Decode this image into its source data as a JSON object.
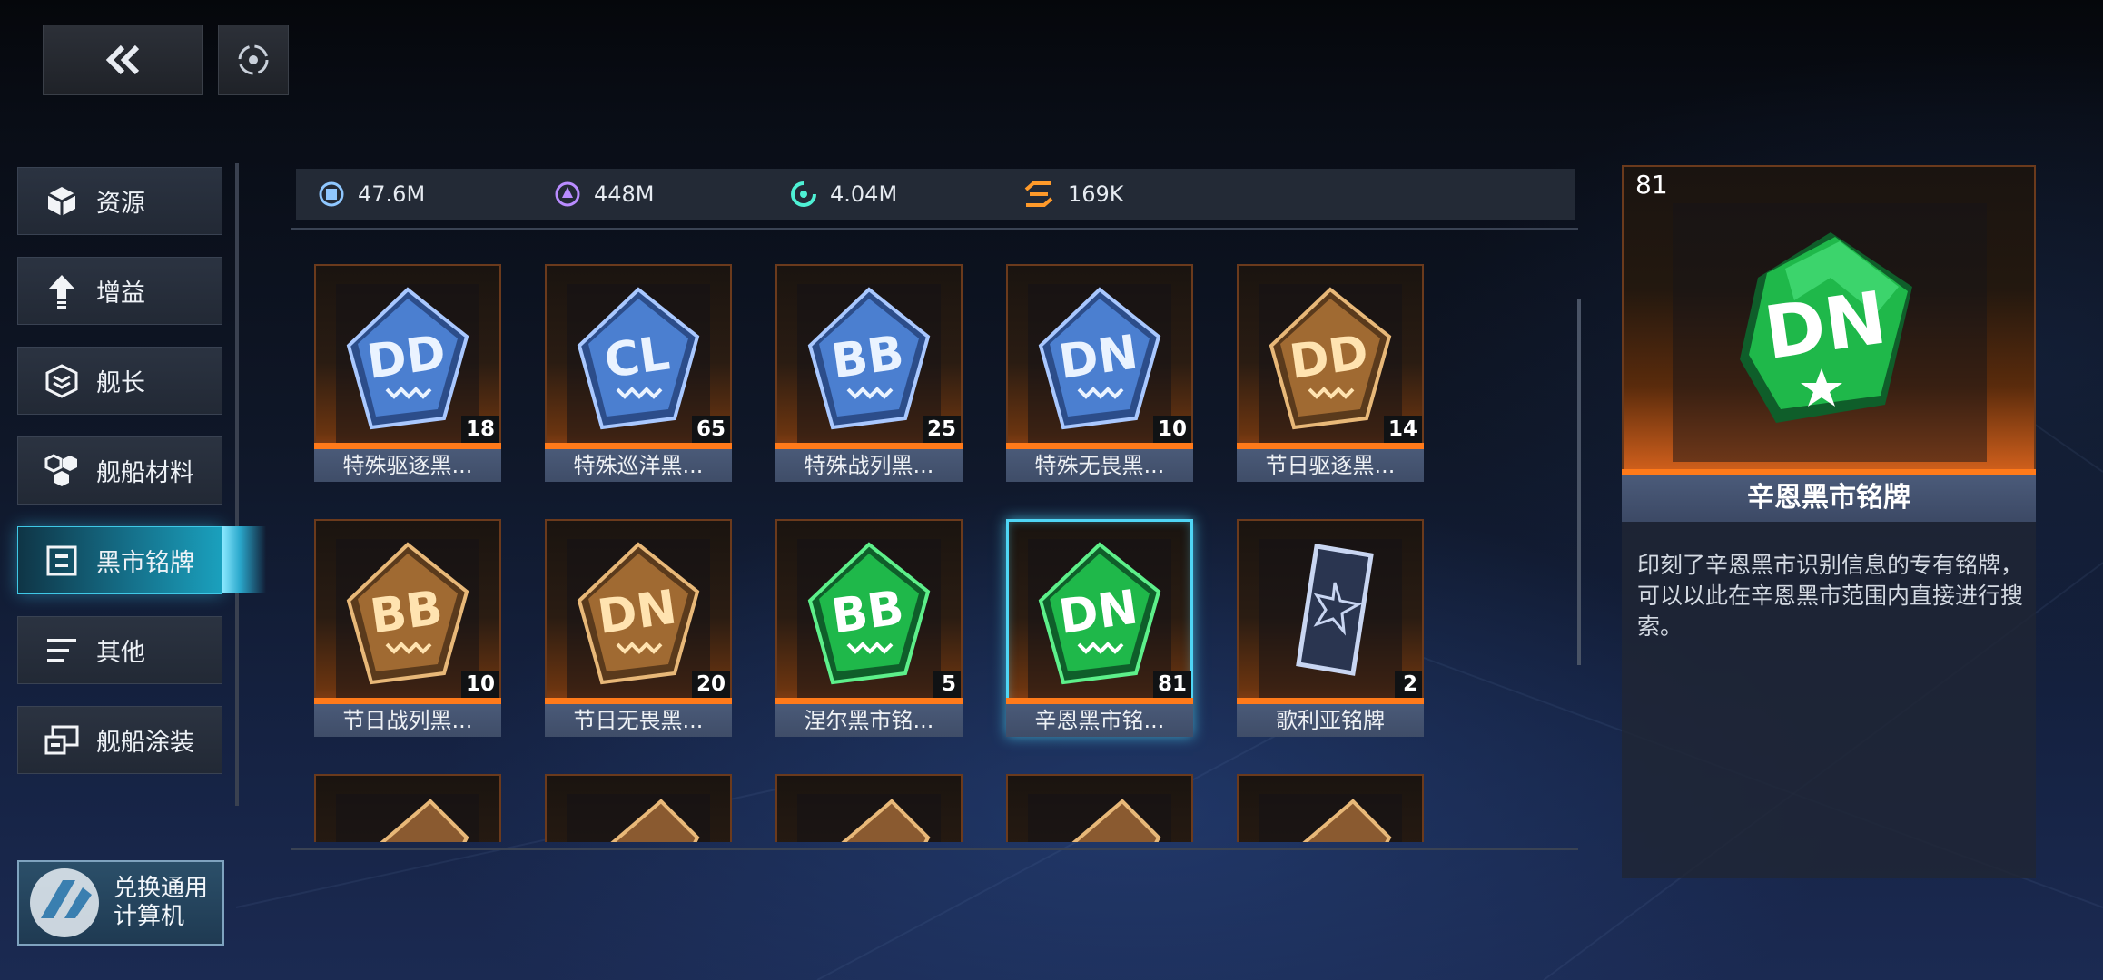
{
  "nav": {
    "back_icon": "double-chevron-left-icon",
    "home_icon": "target-icon"
  },
  "sidebar": {
    "items": [
      {
        "label": "资源",
        "icon": "cube-icon"
      },
      {
        "label": "增益",
        "icon": "upgrade-arrow-icon"
      },
      {
        "label": "舰长",
        "icon": "chevron-stack-icon"
      },
      {
        "label": "舰船材料",
        "icon": "hex-cluster-icon"
      },
      {
        "label": "黑市铭牌",
        "icon": "frame-icon",
        "active": true
      },
      {
        "label": "其他",
        "icon": "lines-icon"
      },
      {
        "label": "舰船涂装",
        "icon": "paint-icon"
      }
    ],
    "calc_button": {
      "line1": "兑换通用",
      "line2": "计算机"
    }
  },
  "currencies": [
    {
      "icon": "metal-icon",
      "value": "47.6M"
    },
    {
      "icon": "crystal-icon",
      "value": "448M"
    },
    {
      "icon": "deuterium-icon",
      "value": "4.04M"
    },
    {
      "icon": "chip-icon",
      "value": "169K"
    }
  ],
  "grid": {
    "items": [
      {
        "name": "特殊驱逐黑...",
        "count": "18",
        "badge": "DD",
        "style": "blue"
      },
      {
        "name": "特殊巡洋黑...",
        "count": "65",
        "badge": "CL",
        "style": "blue"
      },
      {
        "name": "特殊战列黑...",
        "count": "25",
        "badge": "BB",
        "style": "blue"
      },
      {
        "name": "特殊无畏黑...",
        "count": "10",
        "badge": "DN",
        "style": "blue"
      },
      {
        "name": "节日驱逐黑...",
        "count": "14",
        "badge": "DD",
        "style": "gold"
      },
      {
        "name": "节日战列黑...",
        "count": "10",
        "badge": "BB",
        "style": "gold"
      },
      {
        "name": "节日无畏黑...",
        "count": "20",
        "badge": "DN",
        "style": "gold"
      },
      {
        "name": "涅尔黑市铭...",
        "count": "5",
        "badge": "BB",
        "style": "green"
      },
      {
        "name": "辛恩黑市铭...",
        "count": "81",
        "badge": "DN",
        "style": "green",
        "selected": true
      },
      {
        "name": "歌利亚铭牌",
        "count": "2",
        "badge": "",
        "style": "phone"
      }
    ]
  },
  "detail": {
    "count": "81",
    "name": "辛恩黑市铭牌",
    "badge": "DN",
    "description": "印刻了辛恩黑市识别信息的专有铭牌，可以以此在辛恩黑市范围内直接进行搜索。"
  },
  "colors": {
    "accent_cyan": "#4fd6f5",
    "rarity_orange": "#ff7a1a",
    "green_card": "#1fb84a"
  }
}
